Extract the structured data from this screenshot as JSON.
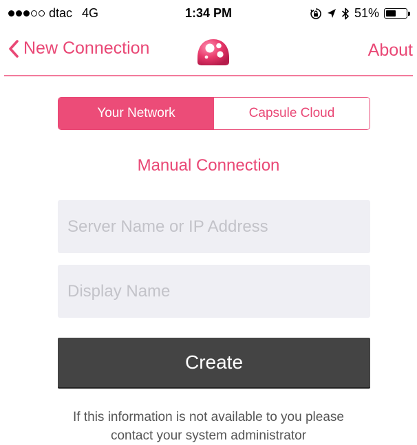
{
  "status_bar": {
    "carrier": "dtac",
    "network": "4G",
    "signal_bars_filled": 3,
    "signal_bars_total": 5,
    "time": "1:34 PM",
    "battery_text": "51%",
    "battery_level": 0.51,
    "icons": [
      "orientation-lock-icon",
      "location-arrow-icon",
      "bluetooth-icon",
      "battery-icon"
    ]
  },
  "nav": {
    "back_label": "New Connection",
    "about_label": "About",
    "logo": "capsule-logo-icon"
  },
  "segments": {
    "your_network": "Your Network",
    "capsule_cloud": "Capsule Cloud",
    "selected": "Your Network"
  },
  "form": {
    "heading": "Manual Connection",
    "server_placeholder": "Server Name or IP Address",
    "server_value": "",
    "display_placeholder": "Display Name",
    "display_value": "",
    "create_label": "Create"
  },
  "help_text": {
    "line1": "If this information is not available to you please",
    "line2": "contact your system administrator"
  },
  "colors": {
    "accent": "#e94775",
    "active_segment": "#ec4c78",
    "field_bg": "#efeff4",
    "button_bg": "#444444"
  }
}
